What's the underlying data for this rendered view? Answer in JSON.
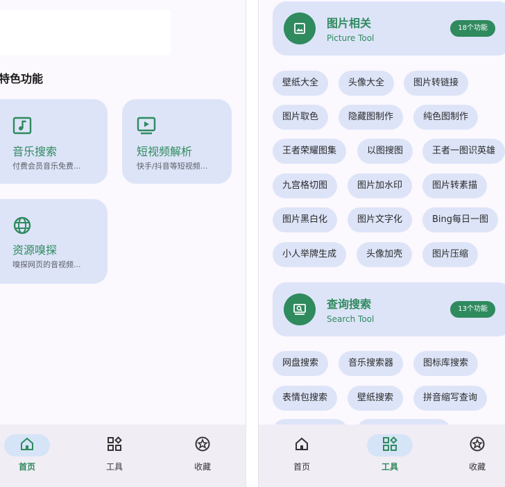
{
  "colors": {
    "accent": "#2f8a5e",
    "card_bg": "#dde4f8",
    "page_bg": "#fbf8fe",
    "nav_bg": "#f1edf5"
  },
  "home": {
    "section_title": "特色功能",
    "cards": [
      {
        "title": "音乐搜索",
        "desc": "付费会员音乐免费...",
        "icon": "music-note-icon"
      },
      {
        "title": "短视频解析",
        "desc": "快手/抖音等短视频...",
        "icon": "video-play-icon"
      },
      {
        "title": "资源嗅探",
        "desc": "嗅探网页的音视频...",
        "icon": "globe-icon"
      }
    ]
  },
  "tools": {
    "categories": [
      {
        "title": "图片相关",
        "subtitle": "Picture Tool",
        "badge": "18个功能",
        "icon": "image-icon",
        "items": [
          "壁纸大全",
          "头像大全",
          "图片转链接",
          "图片取色",
          "隐藏图制作",
          "纯色图制作",
          "王者荣耀图集",
          "以图搜图",
          "王者一图识英雄",
          "九宫格切图",
          "图片加水印",
          "图片转素描",
          "图片黑白化",
          "图片文字化",
          "Bing每日一图",
          "小人举牌生成",
          "头像加壳",
          "图片压缩"
        ]
      },
      {
        "title": "查询搜索",
        "subtitle": "Search Tool",
        "badge": "13个功能",
        "icon": "search-window-icon",
        "items": [
          "网盘搜索",
          "音乐搜索器",
          "图标库搜索",
          "表情包搜索",
          "壁纸搜索",
          "拼音缩写查询"
        ]
      }
    ]
  },
  "nav": {
    "items": [
      {
        "label": "首页",
        "icon": "home-icon"
      },
      {
        "label": "工具",
        "icon": "apps-icon"
      },
      {
        "label": "收藏",
        "icon": "star-badge-icon"
      }
    ]
  }
}
